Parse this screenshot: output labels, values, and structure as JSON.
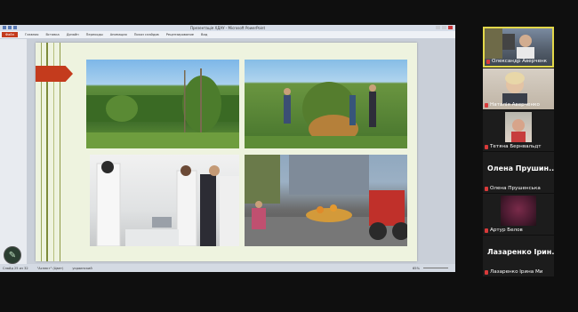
{
  "window": {
    "title": "Презентація ХДАУ - Microsoft PowerPoint"
  },
  "ribbon": {
    "tabs": [
      "Файл",
      "Главная",
      "Вставка",
      "Дизайн",
      "Переходы",
      "Анимация",
      "Показ слайдов",
      "Рецензирование",
      "Вид"
    ]
  },
  "statusbar": {
    "slide": "Слайд 25 из 32",
    "theme": "\"Аспект\" (Цвет)",
    "lang": "украинский",
    "zoom": "65%"
  },
  "participants": [
    {
      "name": "Олександр Аверченк",
      "active": true,
      "video": true
    },
    {
      "name": "Наталія Аверченко",
      "video": true
    },
    {
      "name": "Тетяна Бернвальдт",
      "video": true
    },
    {
      "name": "Олена Прушенська",
      "display": "Олена Прушин...",
      "video": false
    },
    {
      "name": "Артур Белов",
      "video": true
    },
    {
      "name": "Лазаренко Ірина Ми",
      "display": "Лазаренко Ірин...",
      "video": false
    }
  ],
  "colors": {
    "accent": "#c43b1d",
    "slide_bg": "#eef3df",
    "active_border": "#e3d84a"
  }
}
